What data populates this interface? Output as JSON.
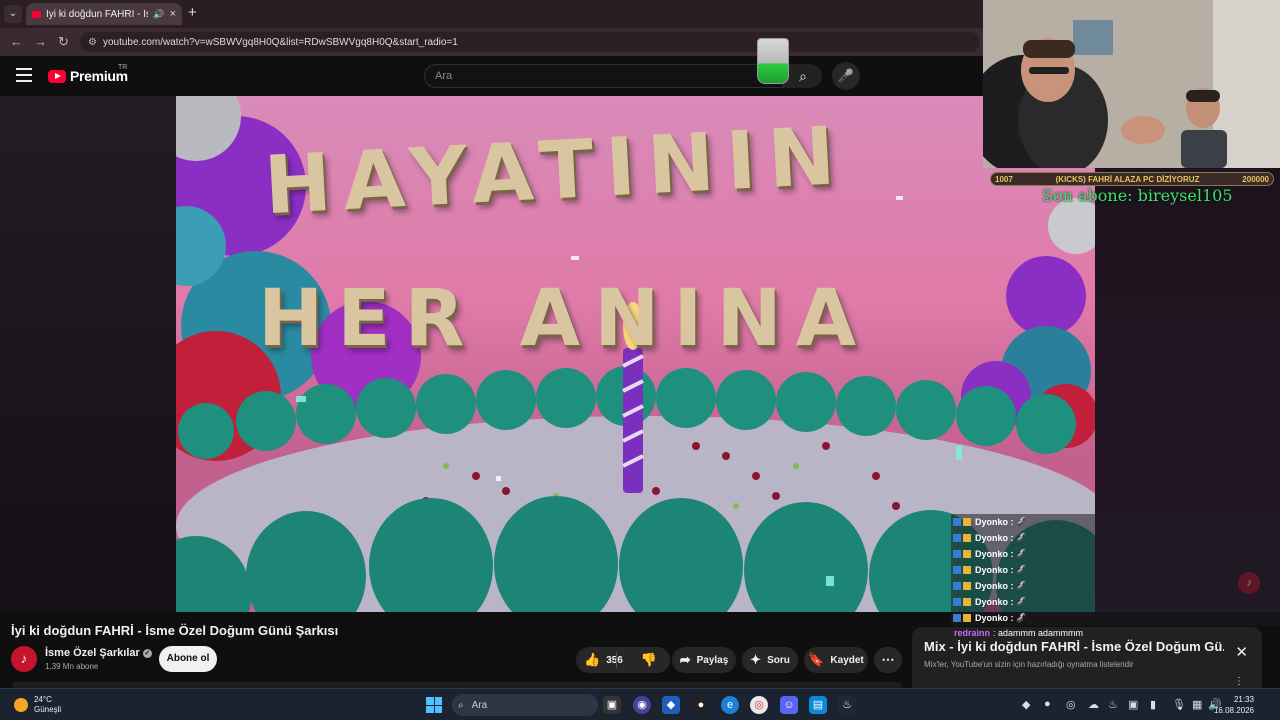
{
  "browser": {
    "tab_title": "İyi ki doğdun FAHRİ - İsme",
    "url": "youtube.com/watch?v=wSBWVgq8H0Q&list=RDwSBWVgq8H0Q&start_radio=1"
  },
  "header": {
    "logo_text": "Premium",
    "region": "TR",
    "search_placeholder": "Ara"
  },
  "video_frame": {
    "line1": "HAYATININ",
    "line2": "HER ANINA"
  },
  "stream_overlay": {
    "goal_current": "1007",
    "goal_label": "(KICKS) FAHRİ ALAZA PC DİZİYORUZ",
    "goal_target": "200000",
    "last_subscriber": "Son abone: bireysel105",
    "chat": [
      {
        "user": "Dyonko :",
        "msg": "🦨"
      },
      {
        "user": "Dyonko :",
        "msg": "🦨"
      },
      {
        "user": "Dyonko :",
        "msg": "🦨"
      },
      {
        "user": "Dyonko :",
        "msg": "🦨"
      },
      {
        "user": "Dyonko :",
        "msg": "🦨"
      },
      {
        "user": "Dyonko :",
        "msg": "🦨"
      },
      {
        "user": "Dyonko :",
        "msg": "🦨"
      }
    ],
    "last_chat": {
      "user": "redrainn",
      "msg": ": adammm adammmm"
    }
  },
  "video": {
    "title": "İyi ki doğdun FAHRİ - İsme Özel Doğum Günü Şarkısı",
    "channel": "İsme Özel Şarkılar",
    "subscribers": "1,39 Mn abone",
    "subscribe_label": "Abone ol",
    "likes": "356",
    "share_label": "Paylaş",
    "ask_label": "Soru",
    "save_label": "Kaydet"
  },
  "mix": {
    "title": "Mix - İyi ki doğdun FAHRİ - İsme Özel Doğum Gü...",
    "subtitle": "Mix'ler, YouTube'un sizin için hazırladığı oynatma listeleridir"
  },
  "taskbar": {
    "temperature": "24°C",
    "weather": "Güneşli",
    "search_placeholder": "Ara",
    "time": "21:33",
    "date": "16.08.2026"
  }
}
